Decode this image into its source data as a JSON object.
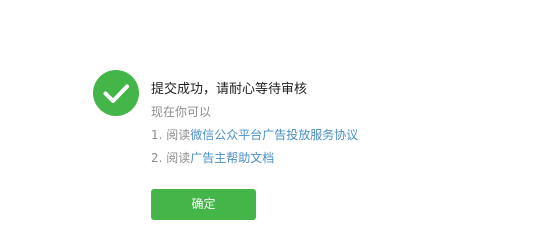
{
  "result": {
    "title": "提交成功，请耐心等待审核",
    "subtitle": "现在你可以",
    "steps": [
      {
        "prefix": "1. 阅读",
        "link": "微信公众平台广告投放服务协议"
      },
      {
        "prefix": "2. 阅读",
        "link": "广告主帮助文档"
      }
    ]
  },
  "actions": {
    "confirm_label": "确定"
  },
  "colors": {
    "success_green": "#44b549",
    "link_blue": "#4a90c8",
    "muted_text": "#8d8d8d"
  },
  "icons": {
    "status": "checkmark-circle-icon"
  }
}
